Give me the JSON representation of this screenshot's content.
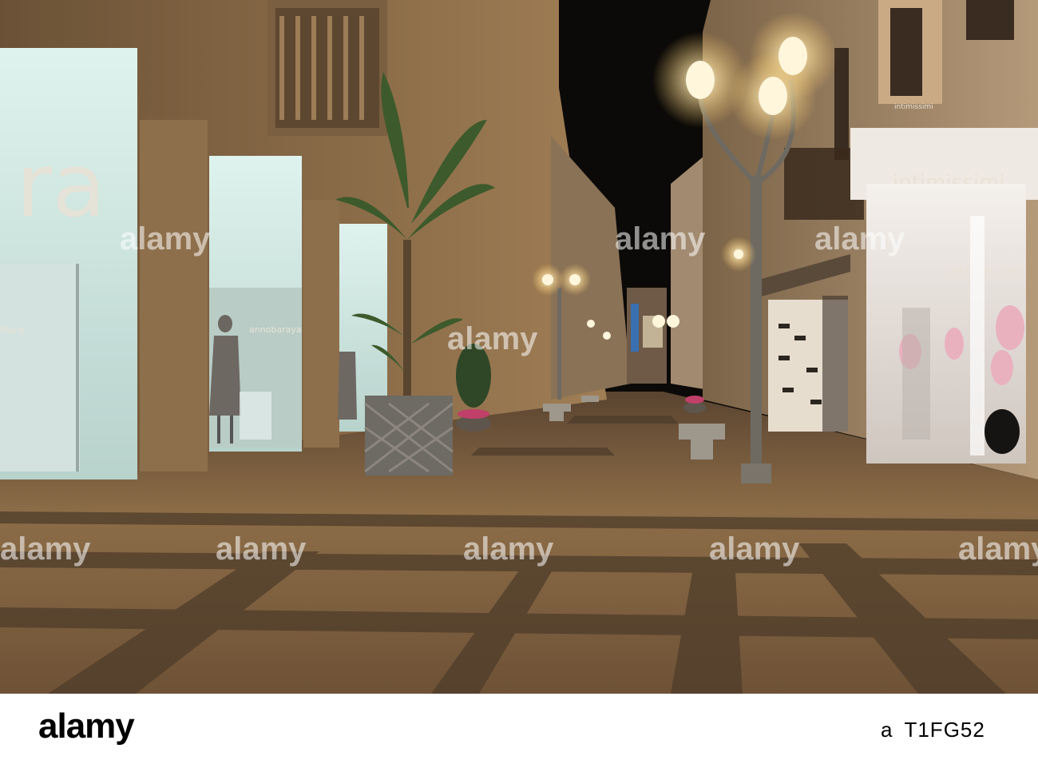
{
  "photo": {
    "alt": "Night pedestrian shopping street with illuminated boutiques and street lamps",
    "signs": {
      "left_store": "ra",
      "left_mara": "Mara",
      "left_store2": "annobaraya",
      "right_store_fascia": "intimissimi",
      "right_store_window": "intimissimi",
      "right_small": "intimissimi"
    },
    "watermarks": [
      "alamy",
      "alamy",
      "alamy",
      "alamy",
      "alamy",
      "alamy",
      "alamy",
      "alamy",
      "alamy"
    ]
  },
  "footer": {
    "brand": "alamy",
    "id_prefix": "a",
    "image_id": "T1FG52"
  },
  "colors": {
    "sky": "#0c0a08",
    "pavement": "#8a6a45",
    "lamp_glow": "#fff2c8",
    "shop_light": "#e8f2ee"
  }
}
